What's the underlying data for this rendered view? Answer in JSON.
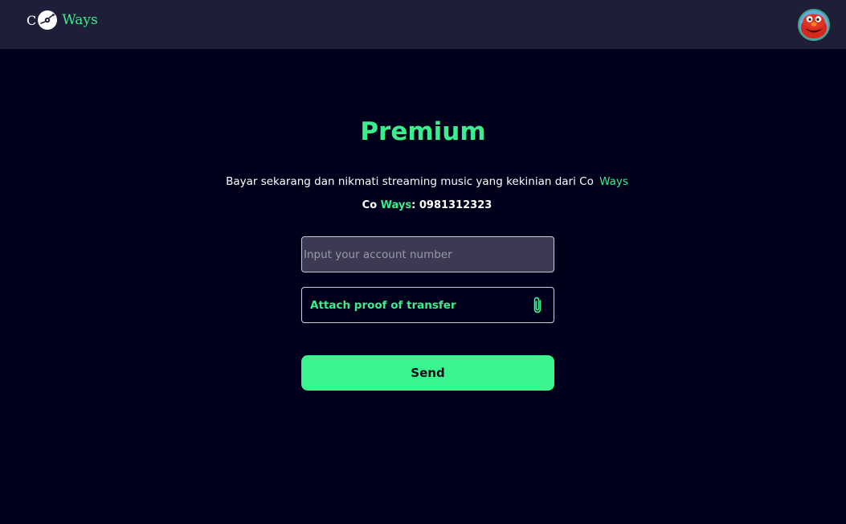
{
  "header": {
    "logo": {
      "prefix": "C",
      "suffix": "Ways",
      "icon": "vinyl-disc-icon"
    },
    "avatar": {
      "icon": "user-avatar"
    }
  },
  "premium": {
    "title": "Premium",
    "description": "Bayar sekarang dan nikmati streaming music yang kekinian dari Co",
    "description_highlight": "Ways",
    "account_brand_prefix": "Co",
    "account_brand_highlight": "Ways",
    "account_number": ": 0981312323",
    "account_input": {
      "value": "",
      "placeholder": "Input your account number"
    },
    "attach_label": "Attach proof of transfer",
    "attach_icon": "paperclip-icon",
    "send_label": "Send"
  },
  "colors": {
    "background": "#01001c",
    "navbar": "#1e1e38",
    "accent": "#3bee8c",
    "button": "#3bf48e",
    "input_bg": "#3b3a52"
  }
}
